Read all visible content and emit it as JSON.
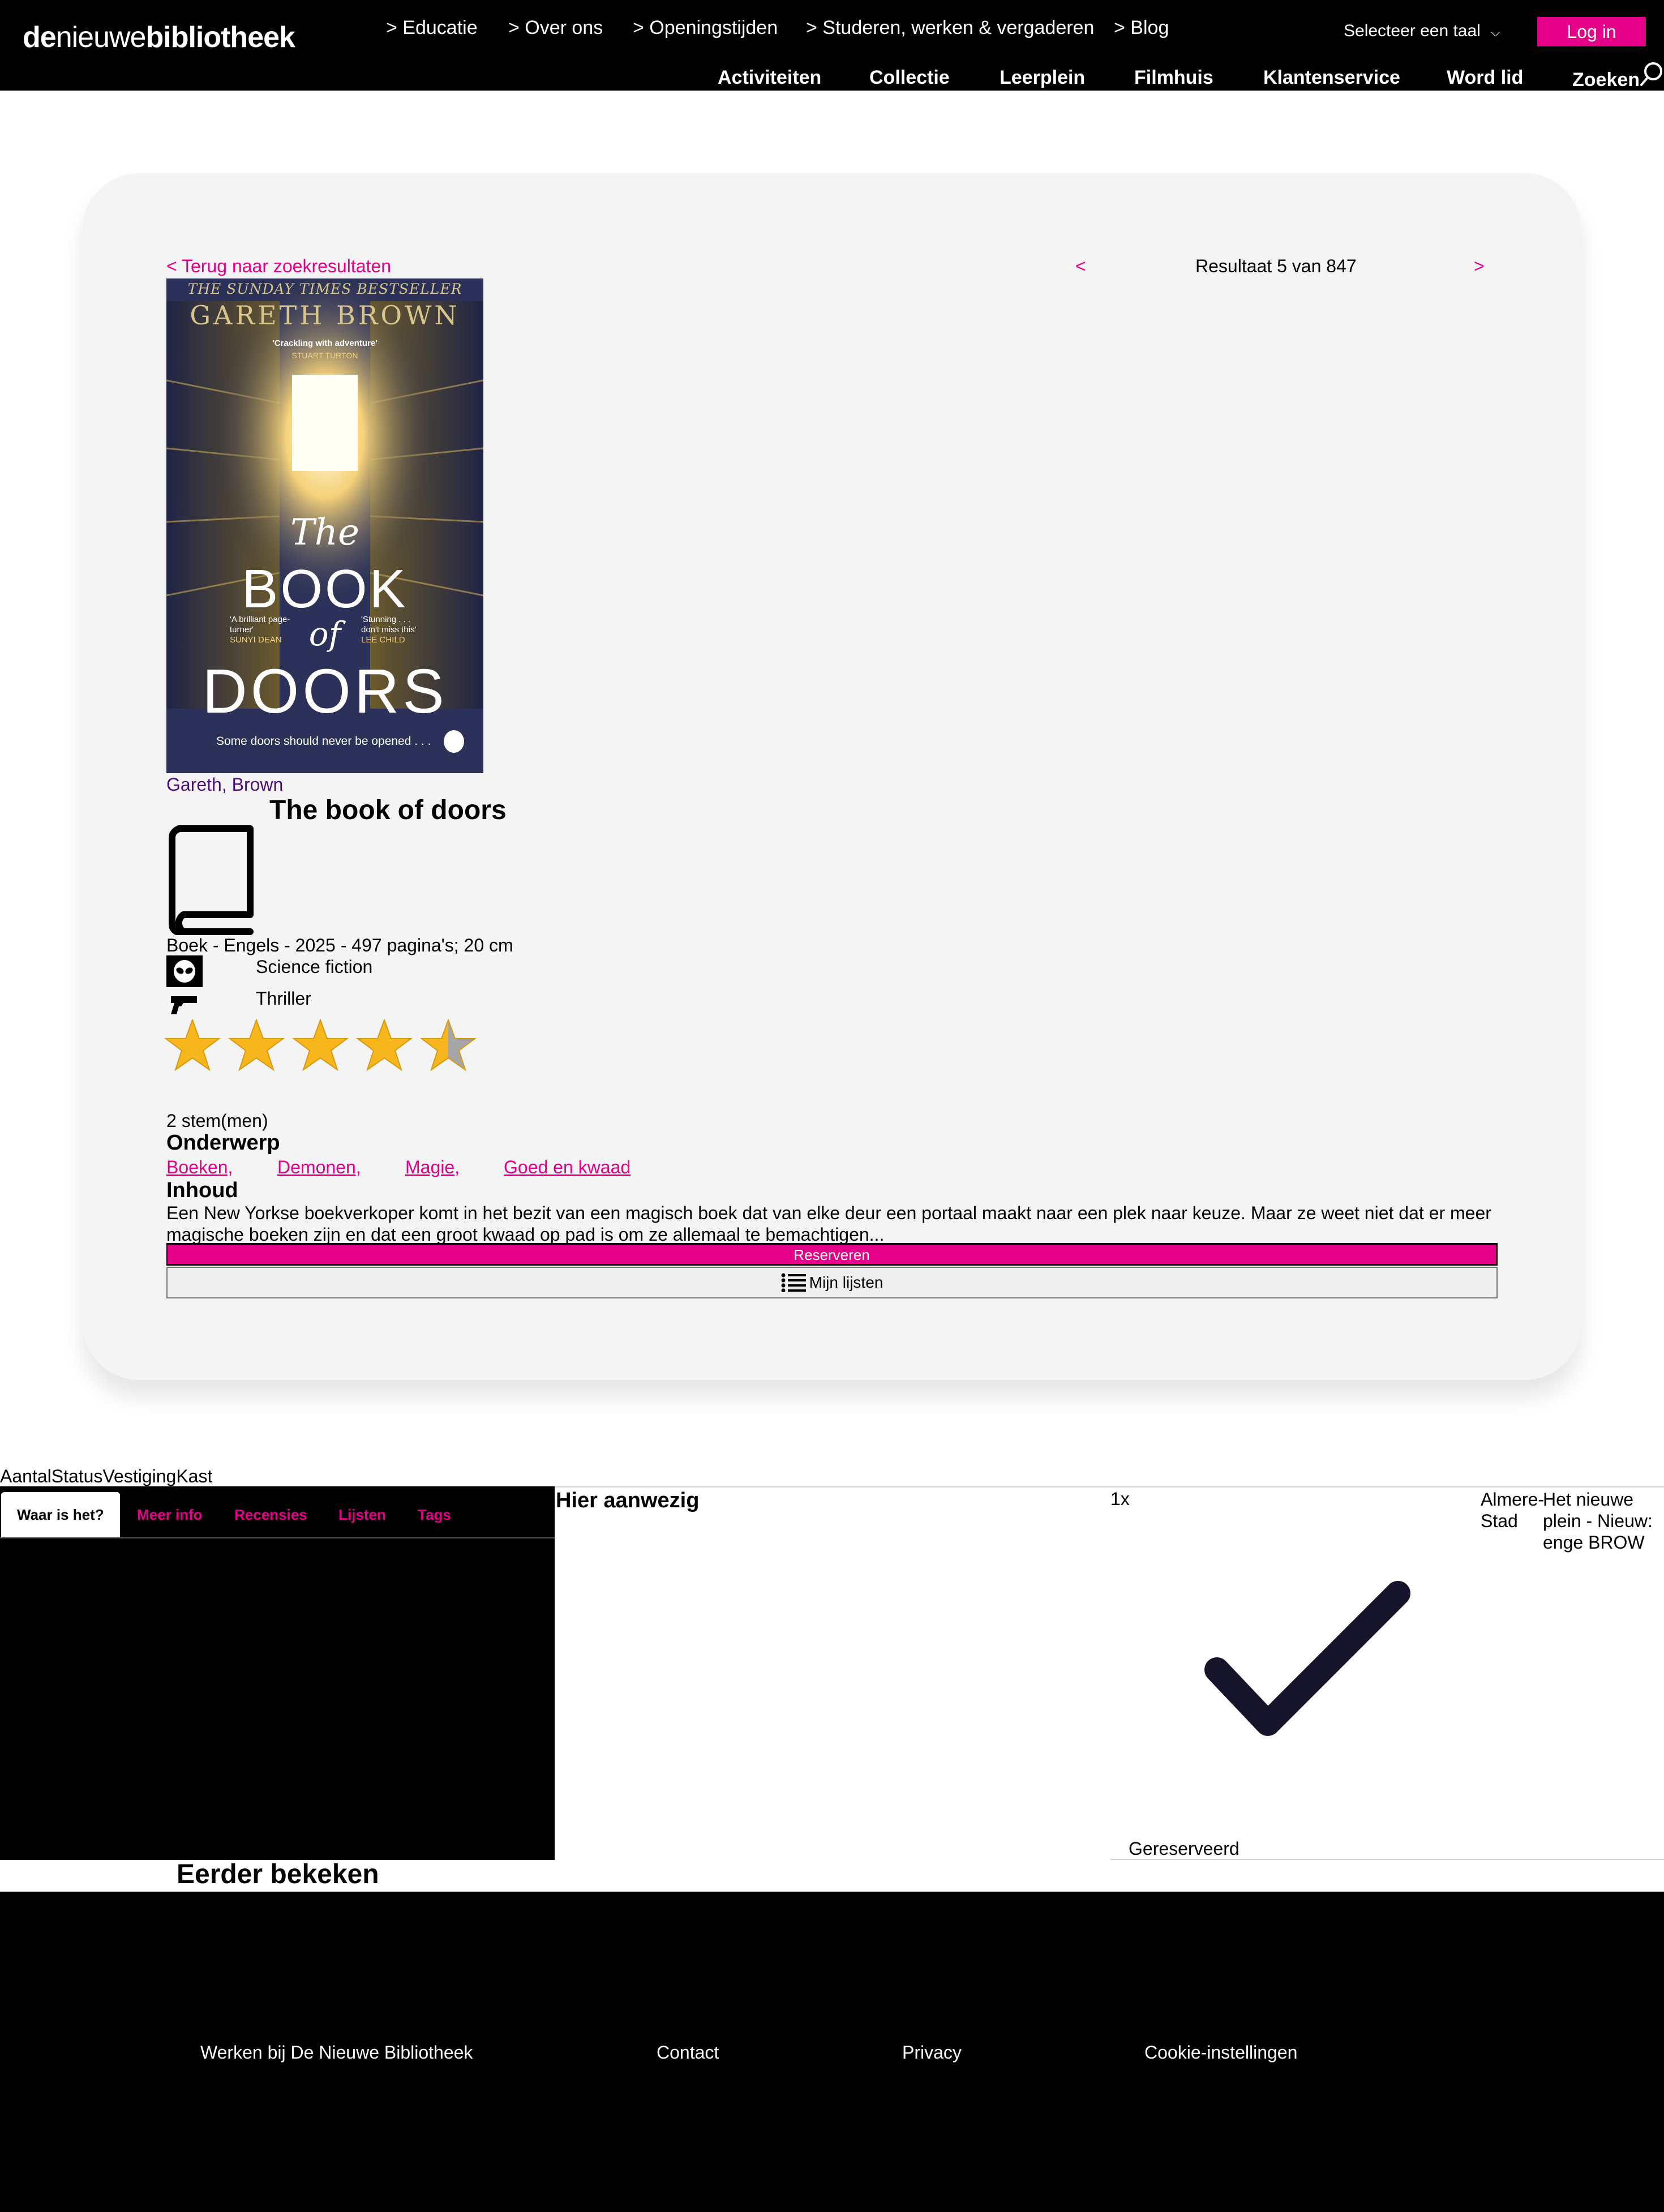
{
  "header": {
    "logo_part1": "de",
    "logo_part2": "nieuwe",
    "logo_part3": "bibliotheek",
    "top_nav": [
      "> Educatie",
      "> Over ons",
      "> Openingstijden",
      "> Studeren, werken & vergaderen",
      "> Blog"
    ],
    "main_nav": [
      "Activiteiten",
      "Collectie",
      "Leerplein",
      "Filmhuis",
      "Klantenservice",
      "Word lid",
      "Zoeken"
    ],
    "language_label": "Selecteer een taal",
    "login_label": "Log in"
  },
  "record": {
    "back_link": "< Terug naar zoekresultaten",
    "prev_label": "<",
    "next_label": ">",
    "result_text": "Resultaat 5 van 847",
    "cover": {
      "bestseller": "THE SUNDAY TIMES BESTSELLER",
      "author": "GARETH BROWN",
      "quote_top": "'Crackling with adventure'",
      "quote_top_by": "STUART TURTON",
      "title_the": "The",
      "title_book": "BOOK",
      "title_of": "of",
      "title_doors": "DOORS",
      "quote_left": "'A brilliant page-turner'",
      "quote_left_by": "SUNYI DEAN",
      "quote_right": "'Stunning . . . don't miss this'",
      "quote_right_by": "LEE CHILD",
      "tagline": "Some doors should never be opened . . ."
    },
    "author": "Gareth, Brown",
    "title": "The book of doors",
    "meta": "Boek - Engels - 2025 - 497 pagina's; 20 cm",
    "genres": [
      "Science fiction",
      "Thriller"
    ],
    "rating": 4.5,
    "votes": "2 stem(men)",
    "subject_heading": "Onderwerp",
    "subjects": [
      "Boeken,",
      "Demonen,",
      "Magie,",
      "Goed en kwaad"
    ],
    "content_heading": "Inhoud",
    "summary": "Een New Yorkse boekverkoper komt in het bezit van een magisch boek dat van elke deur een portaal maakt naar een plek naar keuze. Maar ze weet niet dat er meer magische boeken zijn en dat een groot kwaad op pad is om ze allemaal te bemachtigen...",
    "reserve_label": "Reserveren",
    "lists_label": "Mijn lijsten"
  },
  "availability": {
    "columns": [
      "Aantal",
      "Status",
      "Vestiging",
      "Kast"
    ],
    "tabs": [
      "Waar is het?",
      "Meer info",
      "Recensies",
      "Lijsten",
      "Tags"
    ],
    "status": "Hier aanwezig",
    "quantity": "1x",
    "branch": "Almere-Stad",
    "shelf": "Het nieuwe plein - Nieuw: enge BROW",
    "reserved": "Gereserveerd"
  },
  "recently_viewed": "Eerder bekeken",
  "footer": {
    "links": [
      "Werken bij De Nieuwe Bibliotheek",
      "Contact",
      "Privacy",
      "Cookie-instellingen"
    ]
  },
  "colors": {
    "accent": "#e5008a",
    "header_bg": "#000000",
    "card_bg": "#f4f4f4"
  }
}
